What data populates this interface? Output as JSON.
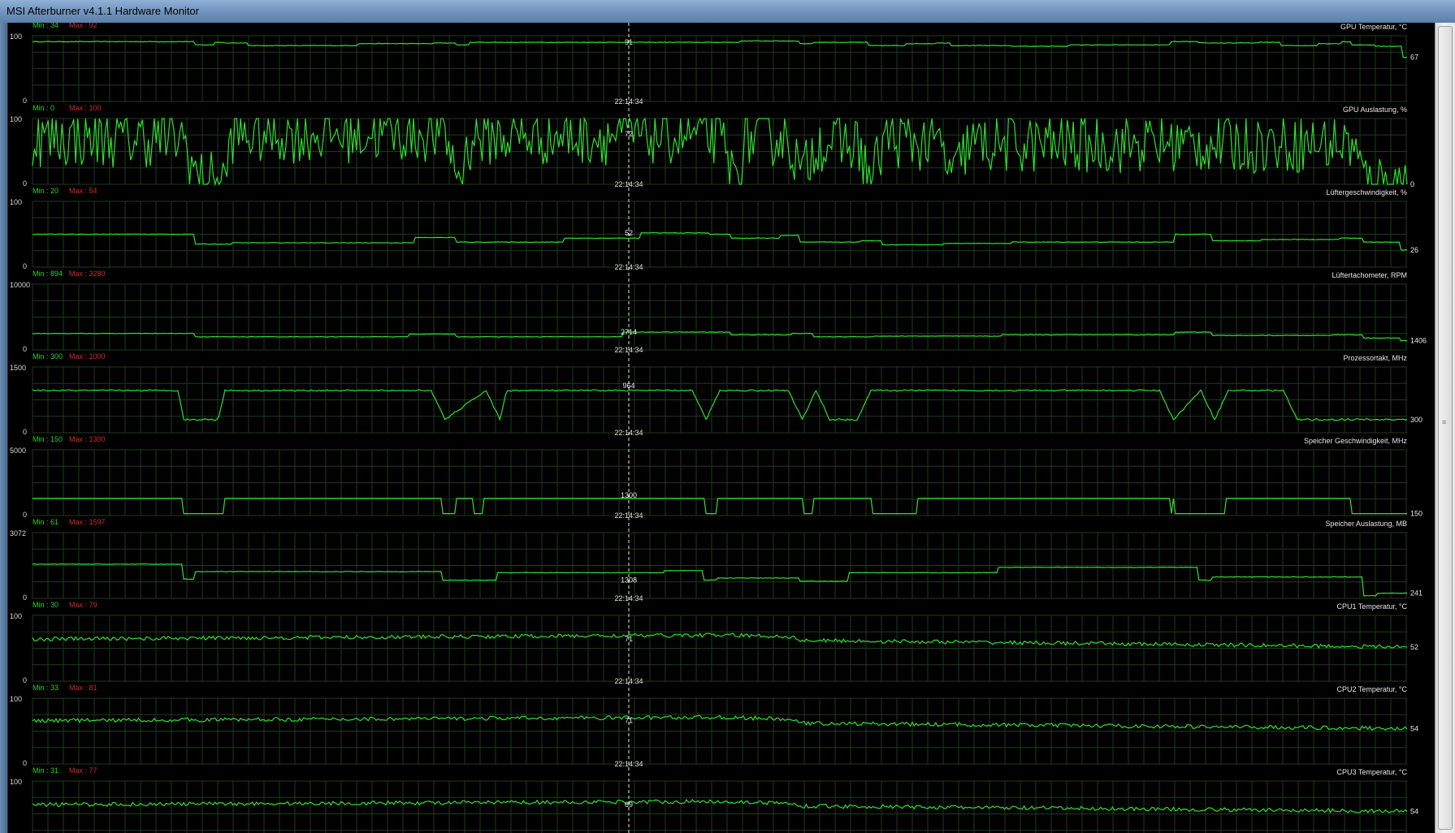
{
  "window": {
    "title": "MSI Afterburner v4.1.1 Hardware Monitor"
  },
  "timestamp": "22:14:34",
  "colors": {
    "background": "#000000",
    "grid": "#1f3a1f",
    "trace": "#2fe02f",
    "min_label": "#23d423",
    "max_label": "#d12a2a",
    "text": "#e6e6e6"
  },
  "icons": {
    "scrollbar_grip": "grip-icon"
  },
  "graphs": [
    {
      "name": "GPU Temperatur, °C",
      "min_label": "Min : 34",
      "max_label": "Max : 92",
      "axis_max": "100",
      "axis_min": "0",
      "current": "67",
      "cursor_value": "91",
      "style": "step",
      "trace": [
        [
          0,
          91
        ],
        [
          0.11,
          91
        ],
        [
          0.12,
          86
        ],
        [
          0.135,
          90
        ],
        [
          0.14,
          89
        ],
        [
          0.16,
          85
        ],
        [
          0.25,
          88
        ],
        [
          0.3,
          89
        ],
        [
          0.31,
          86
        ],
        [
          0.32,
          90
        ],
        [
          0.55,
          92
        ],
        [
          0.56,
          88
        ],
        [
          0.57,
          90
        ],
        [
          0.6,
          90
        ],
        [
          0.61,
          85
        ],
        [
          0.64,
          88
        ],
        [
          0.66,
          89
        ],
        [
          0.67,
          85
        ],
        [
          0.72,
          84
        ],
        [
          0.76,
          86
        ],
        [
          0.84,
          91
        ],
        [
          0.85,
          89
        ],
        [
          0.9,
          90
        ],
        [
          0.91,
          85
        ],
        [
          0.94,
          88
        ],
        [
          0.955,
          91
        ],
        [
          0.96,
          86
        ],
        [
          0.98,
          84
        ],
        [
          1,
          67
        ]
      ]
    },
    {
      "name": "GPU Auslastung, %",
      "min_label": "Min : 0",
      "max_label": "Max : 100",
      "axis_max": "100",
      "axis_min": "0",
      "current": "0",
      "cursor_value": "72",
      "style": "noisy",
      "trace": [
        [
          0,
          70
        ],
        [
          0.11,
          70
        ],
        [
          0.12,
          8
        ],
        [
          0.14,
          6
        ],
        [
          0.145,
          75
        ],
        [
          0.3,
          78
        ],
        [
          0.31,
          10
        ],
        [
          0.32,
          72
        ],
        [
          0.5,
          75
        ],
        [
          0.51,
          8
        ],
        [
          0.52,
          70
        ],
        [
          0.55,
          72
        ],
        [
          0.56,
          10
        ],
        [
          0.57,
          65
        ],
        [
          0.6,
          60
        ],
        [
          0.61,
          5
        ],
        [
          0.62,
          70
        ],
        [
          0.66,
          60
        ],
        [
          0.67,
          8
        ],
        [
          0.68,
          60
        ],
        [
          0.96,
          62
        ],
        [
          0.97,
          5
        ],
        [
          1,
          0
        ]
      ]
    },
    {
      "name": "Lüftergeschwindigkeit, %",
      "min_label": "Min : 20",
      "max_label": "Max : 54",
      "axis_max": "100",
      "axis_min": "0",
      "current": "26",
      "cursor_value": "52",
      "style": "step",
      "trace": [
        [
          0,
          50
        ],
        [
          0.11,
          50
        ],
        [
          0.12,
          35
        ],
        [
          0.15,
          37
        ],
        [
          0.3,
          45
        ],
        [
          0.31,
          38
        ],
        [
          0.4,
          44
        ],
        [
          0.45,
          52
        ],
        [
          0.5,
          50
        ],
        [
          0.51,
          44
        ],
        [
          0.55,
          48
        ],
        [
          0.56,
          38
        ],
        [
          0.61,
          40
        ],
        [
          0.62,
          34
        ],
        [
          0.67,
          36
        ],
        [
          0.72,
          38
        ],
        [
          0.85,
          50
        ],
        [
          0.86,
          40
        ],
        [
          0.9,
          42
        ],
        [
          0.96,
          44
        ],
        [
          0.97,
          38
        ],
        [
          1,
          26
        ]
      ]
    },
    {
      "name": "Lüftertachometer, RPM",
      "min_label": "Min : 894",
      "max_label": "Max : 3280",
      "axis_max": "10000",
      "axis_min": "0",
      "current": "1406",
      "cursor_value": "2714",
      "style": "step",
      "trace": [
        [
          0,
          2500
        ],
        [
          0.11,
          2500
        ],
        [
          0.12,
          2000
        ],
        [
          0.3,
          2400
        ],
        [
          0.31,
          2000
        ],
        [
          0.45,
          2714
        ],
        [
          0.5,
          2700
        ],
        [
          0.51,
          2300
        ],
        [
          0.56,
          2500
        ],
        [
          0.57,
          2000
        ],
        [
          0.62,
          2100
        ],
        [
          0.72,
          2300
        ],
        [
          0.85,
          2700
        ],
        [
          0.86,
          2200
        ],
        [
          0.96,
          2300
        ],
        [
          0.97,
          1800
        ],
        [
          1,
          1406
        ]
      ]
    },
    {
      "name": "Prozessortakt, MHz",
      "min_label": "Min : 300",
      "max_label": "Max : 1000",
      "axis_max": "1500",
      "axis_min": "0",
      "current": "300",
      "cursor_value": "964",
      "style": "noisy",
      "trace": [
        [
          0,
          964
        ],
        [
          0.106,
          964
        ],
        [
          0.11,
          300
        ],
        [
          0.135,
          300
        ],
        [
          0.14,
          964
        ],
        [
          0.29,
          964
        ],
        [
          0.3,
          300
        ],
        [
          0.33,
          964
        ],
        [
          0.34,
          300
        ],
        [
          0.345,
          964
        ],
        [
          0.48,
          964
        ],
        [
          0.49,
          300
        ],
        [
          0.5,
          964
        ],
        [
          0.55,
          964
        ],
        [
          0.56,
          300
        ],
        [
          0.57,
          964
        ],
        [
          0.58,
          300
        ],
        [
          0.6,
          300
        ],
        [
          0.61,
          964
        ],
        [
          0.82,
          964
        ],
        [
          0.83,
          300
        ],
        [
          0.85,
          964
        ],
        [
          0.86,
          300
        ],
        [
          0.87,
          964
        ],
        [
          0.91,
          964
        ],
        [
          0.92,
          300
        ],
        [
          1,
          300
        ]
      ]
    },
    {
      "name": "Speicher Geschwindigkeit, MHz",
      "min_label": "Min : 150",
      "max_label": "Max : 1300",
      "axis_max": "5000",
      "axis_min": "0",
      "current": "150",
      "cursor_value": "1300",
      "style": "pulse",
      "trace": [
        [
          0,
          1300
        ],
        [
          0.106,
          1300
        ],
        [
          0.11,
          150
        ],
        [
          0.135,
          150
        ],
        [
          0.14,
          1300
        ],
        [
          0.29,
          1300
        ],
        [
          0.3,
          150
        ],
        [
          0.31,
          1300
        ],
        [
          0.32,
          150
        ],
        [
          0.33,
          1300
        ],
        [
          0.48,
          1300
        ],
        [
          0.49,
          150
        ],
        [
          0.5,
          1300
        ],
        [
          0.55,
          1300
        ],
        [
          0.56,
          150
        ],
        [
          0.57,
          1300
        ],
        [
          0.6,
          1300
        ],
        [
          0.61,
          150
        ],
        [
          0.65,
          1300
        ],
        [
          0.82,
          1300
        ],
        [
          0.83,
          150
        ],
        [
          0.86,
          150
        ],
        [
          0.87,
          1300
        ],
        [
          0.95,
          1300
        ],
        [
          0.96,
          150
        ],
        [
          1,
          150
        ]
      ]
    },
    {
      "name": "Speicher Auslastung, MB",
      "min_label": "Min : 61",
      "max_label": "Max : 1597",
      "axis_max": "3072",
      "axis_min": "0",
      "current": "241",
      "cursor_value": "1308",
      "style": "step",
      "trace": [
        [
          0,
          1597
        ],
        [
          0.106,
          1597
        ],
        [
          0.11,
          900
        ],
        [
          0.12,
          1250
        ],
        [
          0.29,
          1250
        ],
        [
          0.3,
          850
        ],
        [
          0.33,
          850
        ],
        [
          0.34,
          1200
        ],
        [
          0.48,
          1300
        ],
        [
          0.49,
          850
        ],
        [
          0.5,
          950
        ],
        [
          0.55,
          950
        ],
        [
          0.56,
          800
        ],
        [
          0.6,
          1200
        ],
        [
          0.72,
          1450
        ],
        [
          0.84,
          1450
        ],
        [
          0.85,
          850
        ],
        [
          0.86,
          1000
        ],
        [
          0.96,
          1000
        ],
        [
          0.97,
          120
        ],
        [
          0.98,
          241
        ],
        [
          1,
          241
        ]
      ]
    },
    {
      "name": "CPU1 Temperatur, °C",
      "min_label": "Min : 30",
      "max_label": "Max : 79",
      "axis_max": "100",
      "axis_min": "0",
      "current": "52",
      "cursor_value": "71",
      "style": "jitter",
      "trace": [
        [
          0,
          64
        ],
        [
          0.5,
          70
        ],
        [
          0.55,
          68
        ],
        [
          0.56,
          62
        ],
        [
          1,
          52
        ]
      ]
    },
    {
      "name": "CPU2 Temperatur, °C",
      "min_label": "Min : 33",
      "max_label": "Max : 81",
      "axis_max": "100",
      "axis_min": "0",
      "current": "54",
      "cursor_value": "71",
      "style": "jitter",
      "trace": [
        [
          0,
          66
        ],
        [
          0.5,
          71
        ],
        [
          0.55,
          68
        ],
        [
          0.56,
          62
        ],
        [
          1,
          54
        ]
      ]
    },
    {
      "name": "CPU3 Temperatur, °C",
      "min_label": "Min : 31",
      "max_label": "Max : 77",
      "axis_max": "100",
      "axis_min": "0",
      "current": "54",
      "cursor_value": "69",
      "style": "jitter",
      "trace": [
        [
          0,
          64
        ],
        [
          0.5,
          69
        ],
        [
          0.55,
          66
        ],
        [
          0.56,
          62
        ],
        [
          1,
          54
        ]
      ]
    }
  ]
}
